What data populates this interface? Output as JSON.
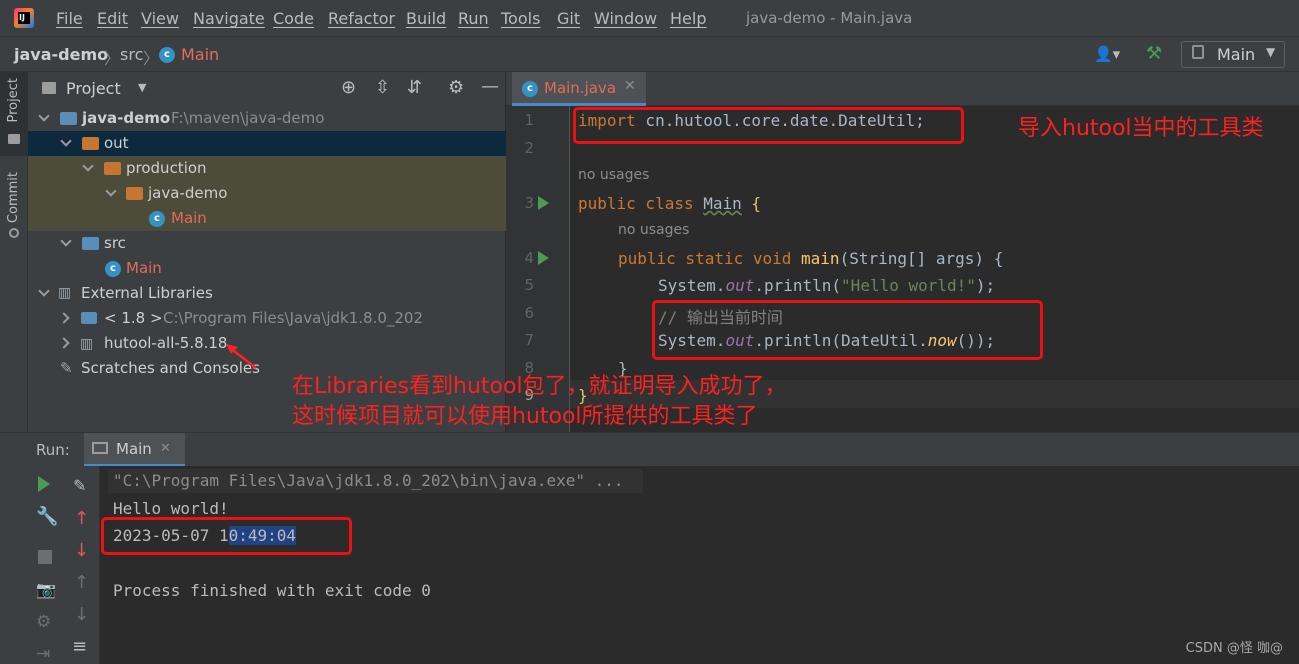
{
  "menubar": {
    "items": [
      "File",
      "Edit",
      "View",
      "Navigate",
      "Code",
      "Refactor",
      "Build",
      "Run",
      "Tools",
      "Git",
      "Window",
      "Help"
    ],
    "window_title": "java-demo - Main.java"
  },
  "navbar": {
    "project": "java-demo",
    "folder": "src",
    "file": "Main",
    "run_config": "Main"
  },
  "left_strip": {
    "project_tab": "Project",
    "commit_tab": "Commit"
  },
  "project_panel": {
    "title": "Project",
    "tree": [
      {
        "label": "java-demo",
        "detail": "F:\\maven\\java-demo"
      },
      {
        "label": "out"
      },
      {
        "label": "production"
      },
      {
        "label": "java-demo"
      },
      {
        "label": "Main"
      },
      {
        "label": "src"
      },
      {
        "label": "Main"
      },
      {
        "label": "External Libraries"
      },
      {
        "label": "< 1.8 >",
        "detail": "C:\\Program Files\\Java\\jdk1.8.0_202"
      },
      {
        "label": "hutool-all-5.8.18"
      },
      {
        "label": "Scratches and Consoles"
      }
    ]
  },
  "editor": {
    "tab_label": "Main.java",
    "line_numbers": [
      "1",
      "2",
      "3",
      "4",
      "5",
      "6",
      "7",
      "8",
      "9"
    ],
    "hint_no_usages": "no usages",
    "lines": {
      "l1_kw": "import",
      "l1_rest": " cn.hutool.core.date.DateUtil;",
      "l3_kw": "public class",
      "l3_name": "Main",
      "l3_brace": "{",
      "l4_kw": "public static void",
      "l4_fn": "main",
      "l4_rest": "(String[] args) {",
      "l5_a": "System.",
      "l5_out": "out",
      "l5_b": ".println(",
      "l5_str": "\"Hello world!\"",
      "l5_c": ");",
      "l6_cmt": "// 输出当前时间",
      "l7_a": "System.",
      "l7_out": "out",
      "l7_b": ".println(DateUtil.",
      "l7_now": "now",
      "l7_c": "());",
      "l8": "}",
      "l9": "}"
    }
  },
  "run_panel": {
    "label": "Run:",
    "tab": "Main",
    "console": {
      "cmd": "\"C:\\Program Files\\Java\\jdk1.8.0_202\\bin\\java.exe\" ...",
      "hello": "Hello world!",
      "date_a": "2023-05-07 1",
      "date_sel": "0:49:04",
      "exit": "Process finished with exit code 0"
    }
  },
  "annotations": {
    "import_note": "导入hutool当中的工具类",
    "libraries_note_1": "在Libraries看到hutool包了，就证明导入成功了，",
    "libraries_note_2": "这时候项目就可以使用hutool所提供的工具类了",
    "color": "#ff2020"
  },
  "watermark": "CSDN @怪 咖@"
}
